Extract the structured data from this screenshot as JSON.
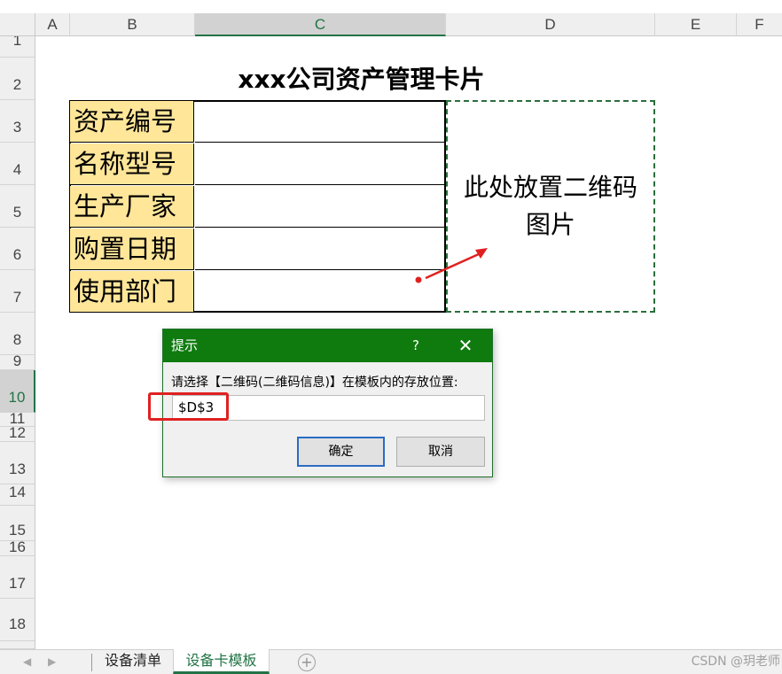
{
  "columns": [
    "A",
    "B",
    "C",
    "D",
    "E",
    "F"
  ],
  "selected_column": "C",
  "rows": [
    "1",
    "2",
    "3",
    "4",
    "5",
    "6",
    "7",
    "8",
    "9",
    "10",
    "11",
    "12",
    "13",
    "14",
    "15",
    "16",
    "17",
    "18"
  ],
  "selected_row": "10",
  "sheet": {
    "title": "xxx公司资产管理卡片",
    "labels": [
      "资产编号",
      "名称型号",
      "生产厂家",
      "购置日期",
      "使用部门"
    ],
    "qr_placeholder": "此处放置二维码图片"
  },
  "dialog": {
    "title": "提示",
    "help": "?",
    "close": "✕",
    "prompt": "请选择【二维码(二维码信息)】在模板内的存放位置:",
    "input_value": "$D$3",
    "ok_label": "确定",
    "cancel_label": "取消"
  },
  "tabs": [
    "设备清单",
    "设备卡模板"
  ],
  "active_tab": "设备卡模板",
  "add_sheet": "+",
  "nav": {
    "prev": "◀",
    "next": "▶"
  },
  "watermark": "CSDN @玥老师",
  "colors": {
    "accent": "#217346",
    "label_fill": "#ffe699",
    "dialog_title": "#0f7b0f",
    "highlight": "#e02020"
  }
}
